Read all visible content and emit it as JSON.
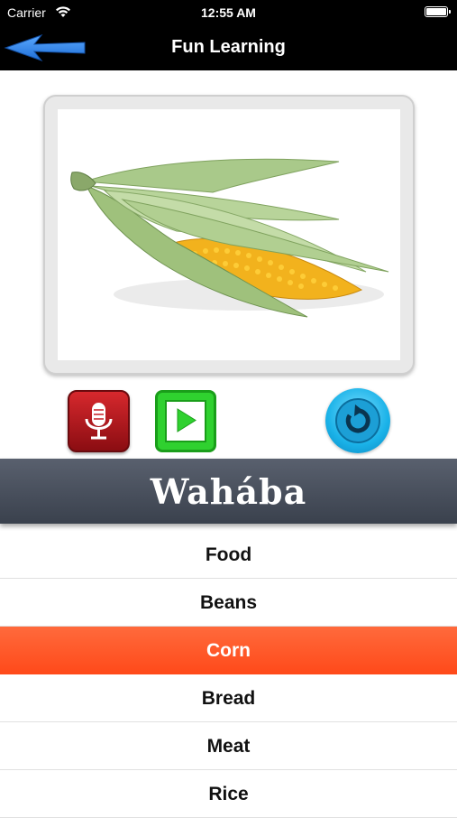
{
  "status_bar": {
    "carrier": "Carrier",
    "time": "12:55 AM",
    "wifi_icon": "wifi-icon",
    "battery_icon": "battery-icon"
  },
  "nav": {
    "title": "Fun Learning",
    "back_icon": "back-arrow-icon"
  },
  "image": {
    "subject": "corn-image"
  },
  "controls": {
    "record_icon": "microphone-icon",
    "play_icon": "play-icon",
    "refresh_icon": "refresh-icon",
    "record_color": "#c41e24",
    "play_color": "#2fd12f",
    "refresh_color": "#1ab2e8"
  },
  "word": "Wahába",
  "list": {
    "items": [
      "Food",
      "Beans",
      "Corn",
      "Bread",
      "Meat",
      "Rice"
    ],
    "selected": "Corn",
    "selected_color": "#ff5a2a"
  }
}
